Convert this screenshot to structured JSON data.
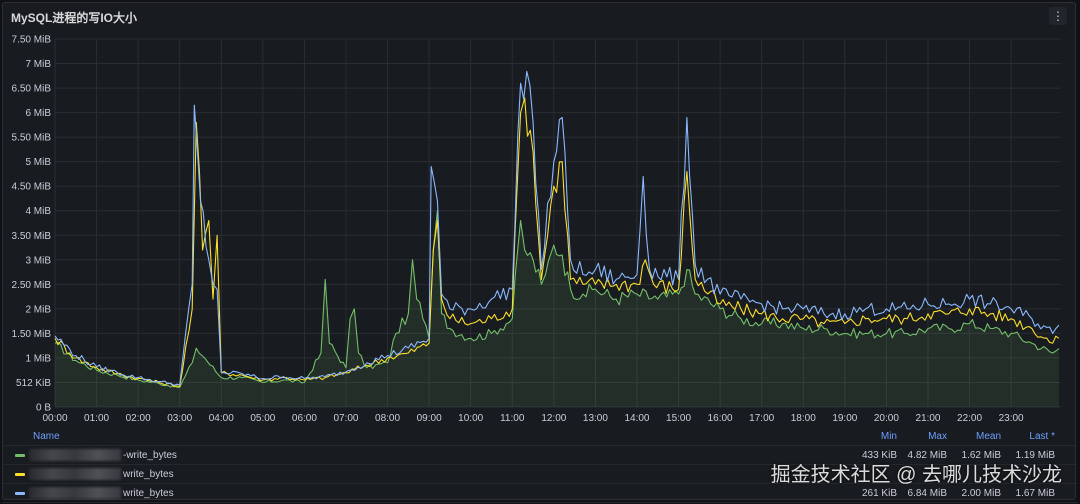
{
  "panel": {
    "title": "MySQL进程的写IO大小",
    "menu_icon": "⋮"
  },
  "chart_data": {
    "type": "line",
    "title": "MySQL进程的写IO大小",
    "x_ticks": [
      "00:00",
      "01:00",
      "02:00",
      "03:00",
      "04:00",
      "05:00",
      "06:00",
      "07:00",
      "08:00",
      "09:00",
      "10:00",
      "11:00",
      "12:00",
      "13:00",
      "14:00",
      "15:00",
      "16:00",
      "17:00",
      "18:00",
      "19:00",
      "20:00",
      "21:00",
      "22:00",
      "23:00"
    ],
    "y_ticks": [
      "0 B",
      "512 KiB",
      "1 MiB",
      "1.50 MiB",
      "2 MiB",
      "2.50 MiB",
      "3 MiB",
      "3.50 MiB",
      "4 MiB",
      "4.50 MiB",
      "5 MiB",
      "5.50 MiB",
      "6 MiB",
      "6.50 MiB",
      "7 MiB",
      "7.50 MiB"
    ],
    "ylim_mib": [
      0,
      7.5
    ],
    "x_unit": "hours",
    "xlim_hours": [
      0,
      24.2
    ],
    "grid": true,
    "series": [
      {
        "label": "-write_bytes",
        "color": "#73bf69",
        "fill": true,
        "points": [
          [
            0,
            1.3
          ],
          [
            0.5,
            0.95
          ],
          [
            1,
            0.75
          ],
          [
            1.5,
            0.65
          ],
          [
            2,
            0.55
          ],
          [
            2.5,
            0.48
          ],
          [
            3,
            0.4
          ],
          [
            3.3,
            0.9
          ],
          [
            3.4,
            1.2
          ],
          [
            3.6,
            1.0
          ],
          [
            4,
            0.6
          ],
          [
            4.5,
            0.6
          ],
          [
            5,
            0.5
          ],
          [
            5.5,
            0.55
          ],
          [
            6,
            0.5
          ],
          [
            6.4,
            1.1
          ],
          [
            6.5,
            2.6
          ],
          [
            6.6,
            1.3
          ],
          [
            7,
            0.8
          ],
          [
            7.1,
            1.8
          ],
          [
            7.2,
            2.0
          ],
          [
            7.3,
            1.1
          ],
          [
            7.5,
            0.8
          ],
          [
            8,
            0.9
          ],
          [
            8.2,
            1.5
          ],
          [
            8.5,
            1.9
          ],
          [
            8.6,
            3.0
          ],
          [
            8.7,
            2.2
          ],
          [
            9,
            1.4
          ],
          [
            9.1,
            3.2
          ],
          [
            9.2,
            4.0
          ],
          [
            9.3,
            1.9
          ],
          [
            9.5,
            1.6
          ],
          [
            10,
            1.4
          ],
          [
            10.5,
            1.5
          ],
          [
            11,
            1.8
          ],
          [
            11.2,
            3.8
          ],
          [
            11.3,
            3.2
          ],
          [
            11.5,
            3.0
          ],
          [
            11.7,
            2.5
          ],
          [
            11.8,
            2.7
          ],
          [
            12,
            3.3
          ],
          [
            12.2,
            3.1
          ],
          [
            12.4,
            2.4
          ],
          [
            12.7,
            2.3
          ],
          [
            13,
            2.4
          ],
          [
            13.5,
            2.2
          ],
          [
            14,
            2.3
          ],
          [
            14.5,
            2.2
          ],
          [
            15,
            2.3
          ],
          [
            15.2,
            2.8
          ],
          [
            15.4,
            2.3
          ],
          [
            16,
            2.0
          ],
          [
            16.5,
            1.8
          ],
          [
            17,
            1.7
          ],
          [
            17.5,
            1.7
          ],
          [
            18,
            1.6
          ],
          [
            18.5,
            1.6
          ],
          [
            19,
            1.5
          ],
          [
            19.5,
            1.5
          ],
          [
            20,
            1.5
          ],
          [
            20.5,
            1.5
          ],
          [
            21,
            1.6
          ],
          [
            21.5,
            1.6
          ],
          [
            22,
            1.7
          ],
          [
            22.5,
            1.6
          ],
          [
            23,
            1.5
          ],
          [
            23.5,
            1.3
          ],
          [
            24,
            1.1
          ],
          [
            24.15,
            1.19
          ]
        ]
      },
      {
        "label": "write_bytes",
        "color": "#fade2a",
        "fill": false,
        "points": [
          [
            0,
            1.4
          ],
          [
            0.5,
            1.0
          ],
          [
            1,
            0.8
          ],
          [
            1.5,
            0.68
          ],
          [
            2,
            0.58
          ],
          [
            2.5,
            0.5
          ],
          [
            3,
            0.42
          ],
          [
            3.3,
            2.0
          ],
          [
            3.4,
            5.8
          ],
          [
            3.55,
            3.2
          ],
          [
            3.7,
            3.8
          ],
          [
            3.8,
            2.2
          ],
          [
            3.9,
            3.5
          ],
          [
            4,
            0.7
          ],
          [
            4.5,
            0.65
          ],
          [
            5,
            0.55
          ],
          [
            5.5,
            0.6
          ],
          [
            6,
            0.55
          ],
          [
            6.5,
            0.6
          ],
          [
            7,
            0.7
          ],
          [
            7.5,
            0.85
          ],
          [
            8,
            1.0
          ],
          [
            8.5,
            1.1
          ],
          [
            9,
            1.3
          ],
          [
            9.1,
            3.2
          ],
          [
            9.2,
            3.8
          ],
          [
            9.3,
            2.2
          ],
          [
            9.5,
            1.8
          ],
          [
            10,
            1.7
          ],
          [
            10.5,
            1.8
          ],
          [
            11,
            2.0
          ],
          [
            11.2,
            6.0
          ],
          [
            11.3,
            6.3
          ],
          [
            11.5,
            5.2
          ],
          [
            11.7,
            2.6
          ],
          [
            12,
            4.5
          ],
          [
            12.2,
            5.0
          ],
          [
            12.4,
            2.6
          ],
          [
            12.7,
            2.5
          ],
          [
            13,
            2.5
          ],
          [
            13.5,
            2.5
          ],
          [
            14,
            2.5
          ],
          [
            14.2,
            3.0
          ],
          [
            14.4,
            2.5
          ],
          [
            15,
            2.4
          ],
          [
            15.2,
            4.8
          ],
          [
            15.4,
            2.6
          ],
          [
            16,
            2.1
          ],
          [
            16.5,
            2.0
          ],
          [
            17,
            1.9
          ],
          [
            17.5,
            1.8
          ],
          [
            18,
            1.8
          ],
          [
            18.5,
            1.7
          ],
          [
            19,
            1.7
          ],
          [
            19.5,
            1.8
          ],
          [
            20,
            1.8
          ],
          [
            20.5,
            1.8
          ],
          [
            21,
            1.9
          ],
          [
            21.5,
            1.9
          ],
          [
            22,
            2.0
          ],
          [
            22.5,
            1.9
          ],
          [
            23,
            1.8
          ],
          [
            23.5,
            1.6
          ],
          [
            24,
            1.3
          ],
          [
            24.15,
            1.4
          ]
        ]
      },
      {
        "label": "write_bytes",
        "color": "#8ab8ff",
        "fill": false,
        "points": [
          [
            0,
            1.45
          ],
          [
            0.5,
            1.05
          ],
          [
            1,
            0.82
          ],
          [
            1.5,
            0.7
          ],
          [
            2,
            0.6
          ],
          [
            2.5,
            0.52
          ],
          [
            3,
            0.45
          ],
          [
            3.3,
            2.5
          ],
          [
            3.35,
            6.15
          ],
          [
            3.5,
            4.2
          ],
          [
            3.7,
            3.0
          ],
          [
            3.8,
            2.5
          ],
          [
            3.9,
            2.4
          ],
          [
            4,
            0.7
          ],
          [
            4.5,
            0.68
          ],
          [
            5,
            0.58
          ],
          [
            5.5,
            0.62
          ],
          [
            6,
            0.58
          ],
          [
            6.5,
            0.62
          ],
          [
            7,
            0.72
          ],
          [
            7.5,
            0.9
          ],
          [
            8,
            1.05
          ],
          [
            8.5,
            1.2
          ],
          [
            9,
            1.4
          ],
          [
            9.05,
            4.9
          ],
          [
            9.2,
            4.2
          ],
          [
            9.3,
            2.3
          ],
          [
            9.5,
            2.0
          ],
          [
            10,
            2.0
          ],
          [
            10.5,
            2.2
          ],
          [
            11,
            2.4
          ],
          [
            11.2,
            6.6
          ],
          [
            11.35,
            6.84
          ],
          [
            11.5,
            5.8
          ],
          [
            11.7,
            2.8
          ],
          [
            12,
            5.0
          ],
          [
            12.2,
            5.9
          ],
          [
            12.4,
            3.0
          ],
          [
            12.7,
            2.7
          ],
          [
            13,
            2.8
          ],
          [
            13.5,
            2.6
          ],
          [
            14,
            2.7
          ],
          [
            14.15,
            4.7
          ],
          [
            14.3,
            2.8
          ],
          [
            15,
            2.6
          ],
          [
            15.2,
            5.9
          ],
          [
            15.4,
            2.9
          ],
          [
            16,
            2.3
          ],
          [
            16.5,
            2.2
          ],
          [
            17,
            2.1
          ],
          [
            17.5,
            2.0
          ],
          [
            18,
            2.0
          ],
          [
            18.5,
            1.9
          ],
          [
            19,
            1.9
          ],
          [
            19.5,
            2.0
          ],
          [
            20,
            2.0
          ],
          [
            20.5,
            2.0
          ],
          [
            21,
            2.1
          ],
          [
            21.5,
            2.1
          ],
          [
            22,
            2.2
          ],
          [
            22.5,
            2.1
          ],
          [
            23,
            2.0
          ],
          [
            23.5,
            1.8
          ],
          [
            24,
            1.5
          ],
          [
            24.15,
            1.67
          ]
        ]
      }
    ]
  },
  "legend": {
    "headers": {
      "name": "Name",
      "min": "Min",
      "max": "Max",
      "mean": "Mean",
      "last": "Last *"
    },
    "rows": [
      {
        "color": "#73bf69",
        "label": "-write_bytes",
        "min": "433 KiB",
        "max": "4.82 MiB",
        "mean": "1.62 MiB",
        "last": "1.19 MiB"
      },
      {
        "color": "#fade2a",
        "label": "write_bytes",
        "min": "",
        "max": "",
        "mean": "",
        "last": ""
      },
      {
        "color": "#8ab8ff",
        "label": "write_bytes",
        "min": "261 KiB",
        "max": "6.84 MiB",
        "mean": "2.00 MiB",
        "last": "1.67 MiB"
      }
    ]
  },
  "watermark": "掘金技术社区 @ 去哪儿技术沙龙"
}
